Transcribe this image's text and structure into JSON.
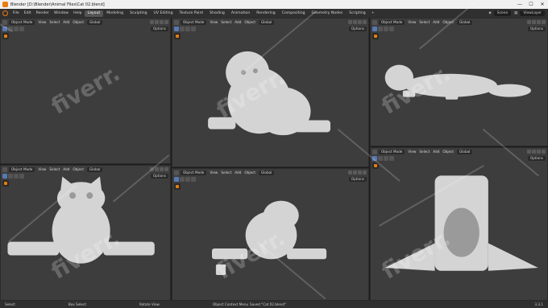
{
  "window": {
    "title": "Blender [D:\\Blender\\Animal Files\\Cat 02.blend]",
    "buttons": [
      "—",
      "☐",
      "✕"
    ]
  },
  "topbar": {
    "menus": [
      "File",
      "Edit",
      "Render",
      "Window",
      "Help"
    ],
    "tabs": [
      "Layout",
      "Modeling",
      "Sculpting",
      "UV Editing",
      "Texture Paint",
      "Shading",
      "Animation",
      "Rendering",
      "Compositing",
      "Geometry Nodes",
      "Scripting"
    ],
    "active_tab": "Layout",
    "plus": "+",
    "scene": "Scene",
    "view_layer": "ViewLayer"
  },
  "viewports": [
    {
      "mode": "Object Mode",
      "menus": [
        "View",
        "Select",
        "Add",
        "Object"
      ],
      "orientation": "Global",
      "options": "Options"
    },
    {
      "mode": "Object Mode",
      "menus": [
        "View",
        "Select",
        "Add",
        "Object"
      ],
      "orientation": "Global",
      "options": "Options"
    },
    {
      "mode": "Object Mode",
      "menus": [
        "View",
        "Select",
        "Add",
        "Object"
      ],
      "orientation": "Global",
      "options": "Options"
    },
    {
      "mode": "Object Mode",
      "menus": [
        "View",
        "Select",
        "Add",
        "Object"
      ],
      "orientation": "Global",
      "options": "Options"
    },
    {
      "mode": "Object Mode",
      "menus": [
        "View",
        "Select",
        "Add",
        "Object"
      ],
      "orientation": "Global",
      "options": "Options"
    },
    {
      "mode": "Object Mode",
      "menus": [
        "View",
        "Select",
        "Add",
        "Object"
      ],
      "orientation": "Global",
      "options": "Options"
    }
  ],
  "watermark": "fiverr.",
  "statusbar": {
    "items": [
      "Select",
      "Box Select",
      "Rotate View",
      "Object Context Menu"
    ],
    "message": "Saved \"Cat 02.blend\"",
    "version": "3.3.1"
  },
  "colors": {
    "accent": "#e87d0d",
    "viewport_bg": "#3d3d3d",
    "model": "#d4d4d4"
  }
}
